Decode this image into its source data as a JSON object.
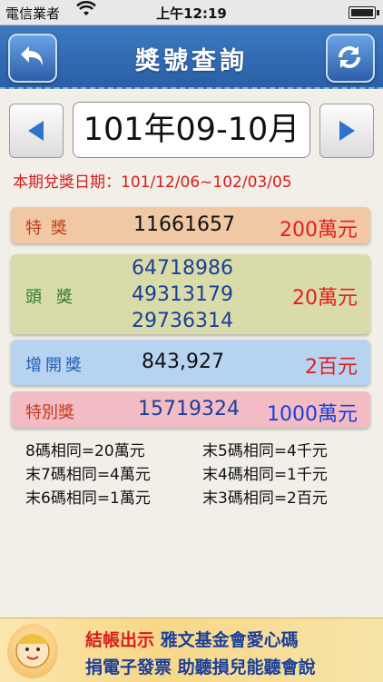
{
  "status_bar": {
    "carrier": "電信業者",
    "time": "上午12:19"
  },
  "nav": {
    "title": "獎號查詢",
    "back_icon": "back-arrow-icon",
    "refresh_icon": "refresh-icon"
  },
  "period": {
    "label": "101年09-10月",
    "claim_period": "本期兌獎日期：101/12/06~102/03/05"
  },
  "prizes": {
    "special": {
      "label": "特獎",
      "number": "11661657",
      "amount": "200萬元"
    },
    "grand": {
      "label": "頭獎",
      "numbers": [
        "64718986",
        "49313179",
        "29736314"
      ],
      "amount": "20萬元"
    },
    "additional": {
      "label": "增開獎",
      "number": "843,927",
      "amount": "2百元"
    },
    "super": {
      "label": "特別獎",
      "number": "15719324",
      "amount": "1000萬元"
    }
  },
  "rules": {
    "left": [
      "8碼相同=20萬元",
      "末7碼相同=4萬元",
      "末6碼相同=1萬元"
    ],
    "right": [
      "末5碼相同=4千元",
      "末4碼相同=1千元",
      "末3碼相同=2百元"
    ]
  },
  "ad": {
    "line1_a": "結帳出示",
    "line1_b": "雅文基金會愛心碼",
    "line2_a": "捐電子發票",
    "line2_b": "助聽損兒能聽會說"
  },
  "colors": {
    "nav_blue": "#2f67ad",
    "accent_red": "#e02020",
    "accent_blue": "#1a3f9a"
  }
}
